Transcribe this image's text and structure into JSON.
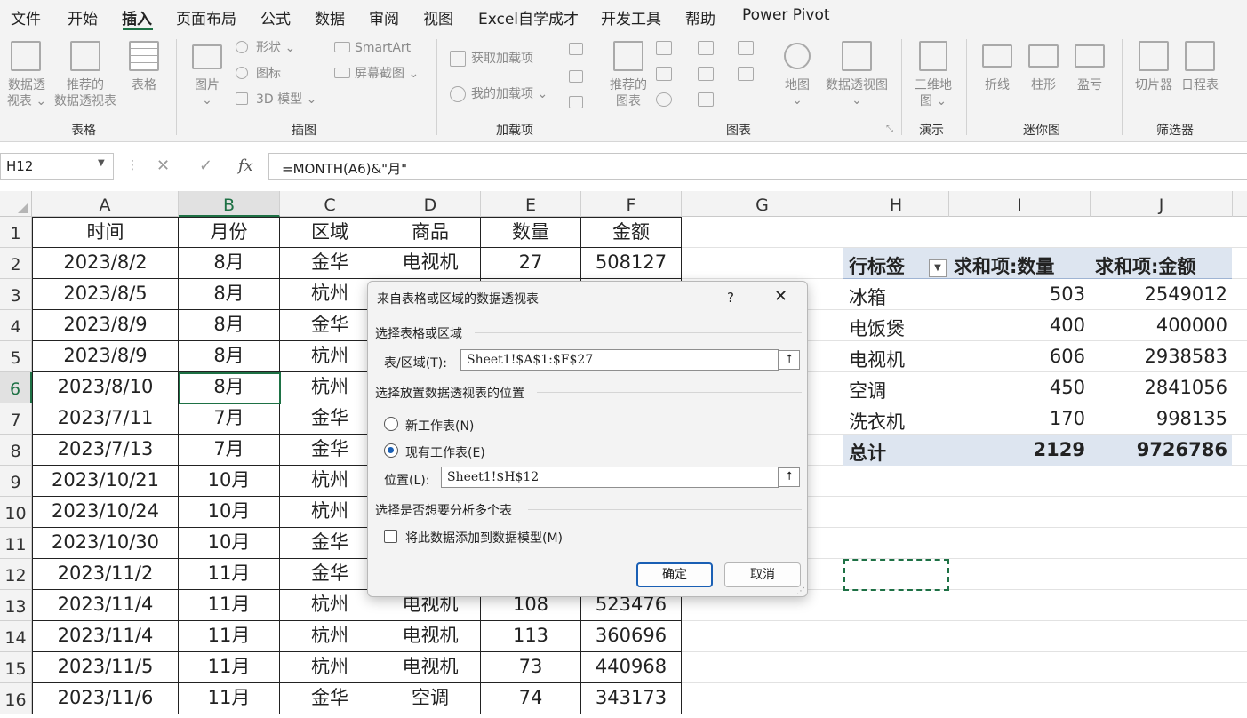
{
  "menu": [
    "文件",
    "开始",
    "插入",
    "页面布局",
    "公式",
    "数据",
    "审阅",
    "视图",
    "Excel自学成才",
    "开发工具",
    "帮助",
    "Power Pivot"
  ],
  "ribbon": {
    "pivot": "数据透",
    "pivot2": "视表 ⌄",
    "rec": "推荐的",
    "rec2": "数据透视表",
    "table": "表格",
    "grp_table": "表格",
    "pic": "图片",
    "pic_arrow": "⌄",
    "shape": "形状 ⌄",
    "icon": "图标",
    "model3d": "3D 模型  ⌄",
    "smartart": "SmartArt",
    "screenshot": "屏幕截图 ⌄",
    "grp_illus": "插图",
    "getaddin": "获取加载项",
    "myaddin": "我的加载项  ⌄",
    "grp_addin": "加载项",
    "recchart": "推荐的",
    "recchart2": "图表",
    "map": "地图",
    "map_arrow": "⌄",
    "pivotchart": "数据透视图",
    "pivotchart_arrow": "⌄",
    "grp_chart": "图表",
    "map3d": "三维地",
    "map3d2": "图 ⌄",
    "grp_tour": "演示",
    "line": "折线",
    "col": "柱形",
    "wl": "盈亏",
    "grp_spark": "迷你图",
    "slicer": "切片器",
    "timeline": "日程表",
    "grp_filter": "筛选器"
  },
  "formula": {
    "namebox": "H12",
    "fx": "fx",
    "content": "=MONTH(A6)&\"月\"",
    "cancel": "✕",
    "enter": "✓"
  },
  "columns": [
    "A",
    "B",
    "C",
    "D",
    "E",
    "F",
    "G",
    "H",
    "I",
    "J"
  ],
  "rows": [
    "1",
    "2",
    "3",
    "4",
    "5",
    "6",
    "7",
    "8",
    "9",
    "10",
    "11",
    "12",
    "13",
    "14",
    "15",
    "16"
  ],
  "table": {
    "header": [
      "时间",
      "月份",
      "区域",
      "商品",
      "数量",
      "金额"
    ],
    "rows": [
      [
        "2023/8/2",
        "8月",
        "金华",
        "电视机",
        "27",
        "508127"
      ],
      [
        "2023/8/5",
        "8月",
        "杭州",
        "",
        "",
        ""
      ],
      [
        "2023/8/9",
        "8月",
        "金华",
        "",
        "",
        ""
      ],
      [
        "2023/8/9",
        "8月",
        "杭州",
        "",
        "",
        ""
      ],
      [
        "2023/8/10",
        "8月",
        "杭州",
        "",
        "",
        ""
      ],
      [
        "2023/7/11",
        "7月",
        "金华",
        "",
        "",
        ""
      ],
      [
        "2023/7/13",
        "7月",
        "金华",
        "",
        "",
        ""
      ],
      [
        "2023/10/21",
        "10月",
        "杭州",
        "",
        "",
        ""
      ],
      [
        "2023/10/24",
        "10月",
        "杭州",
        "",
        "",
        ""
      ],
      [
        "2023/10/30",
        "10月",
        "金华",
        "",
        "",
        ""
      ],
      [
        "2023/11/2",
        "11月",
        "金华",
        "",
        "",
        ""
      ],
      [
        "2023/11/4",
        "11月",
        "杭州",
        "电视机",
        "108",
        "523476"
      ],
      [
        "2023/11/4",
        "11月",
        "杭州",
        "电视机",
        "113",
        "360696"
      ],
      [
        "2023/11/5",
        "11月",
        "杭州",
        "电视机",
        "73",
        "440968"
      ],
      [
        "2023/11/6",
        "11月",
        "金华",
        "空调",
        "74",
        "343173"
      ]
    ]
  },
  "pivot": {
    "header": [
      "行标签",
      "求和项:数量",
      "求和项:金额"
    ],
    "rows": [
      [
        "冰箱",
        "503",
        "2549012"
      ],
      [
        "电饭煲",
        "400",
        "400000"
      ],
      [
        "电视机",
        "606",
        "2938583"
      ],
      [
        "空调",
        "450",
        "2841056"
      ],
      [
        "洗衣机",
        "170",
        "998135"
      ]
    ],
    "total": [
      "总计",
      "2129",
      "9726786"
    ],
    "header_bg": "#dde5f0"
  },
  "dialog": {
    "title": "来自表格或区域的数据透视表",
    "help": "?",
    "close": "✕",
    "sec1": "选择表格或区域",
    "range_label": "表/区域(T):",
    "range_value": "Sheet1!$A$1:$F$27",
    "sec2": "选择放置数据透视表的位置",
    "new_ws": "新工作表(N)",
    "exist_ws": "现有工作表(E)",
    "loc_label": "位置(L):",
    "loc_value": "Sheet1!$H$12",
    "sec3": "选择是否想要分析多个表",
    "add_model": "将此数据添加到数据模型(M)",
    "ok": "确定",
    "cancel": "取消",
    "up": "⭡"
  },
  "accent": "#1e7145"
}
